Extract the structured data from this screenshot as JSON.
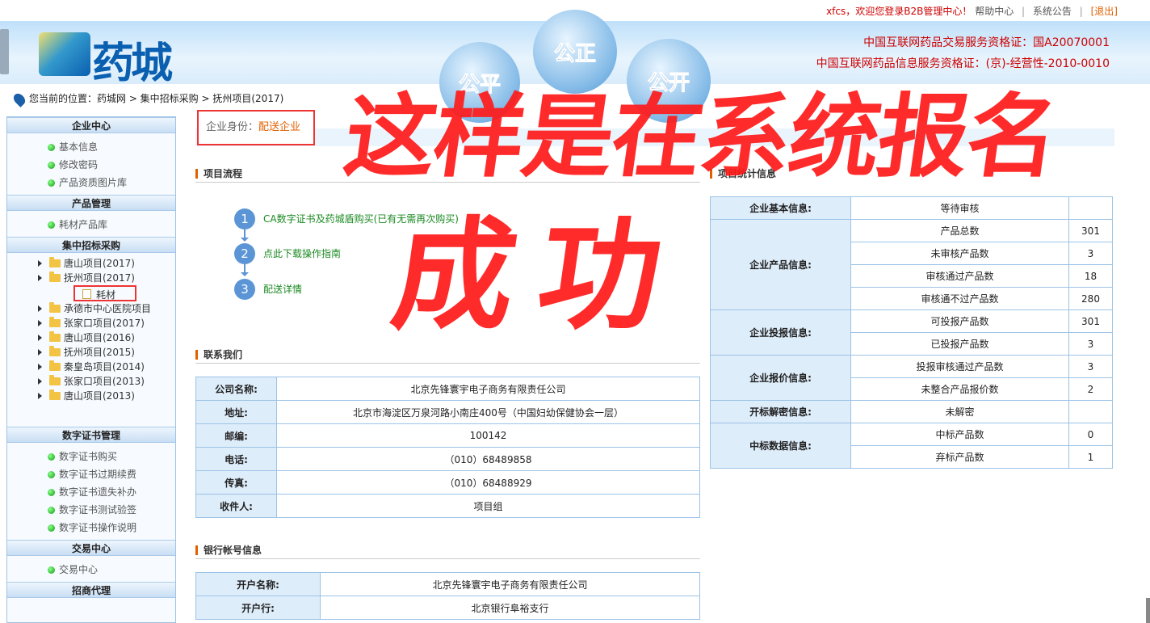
{
  "topbar": {
    "welcome": "xfcs，欢迎您登录B2B管理中心！",
    "help": "帮助中心",
    "notice": "系统公告",
    "logout": "[退出]",
    "sep": "|"
  },
  "header": {
    "logo_text": "药城",
    "bubbles": [
      "公平",
      "公正",
      "公开"
    ],
    "cert1": "中国互联网药品交易服务资格证：国A20070001",
    "cert2": "中国互联网药品信息服务资格证：(京)-经营性-2010-0010"
  },
  "breadcrumb": "您当前的位置：药城网 > 集中招标采购 > 抚州项目(2017)",
  "sidebar": {
    "sections": [
      {
        "title": "企业中心",
        "items": [
          "基本信息",
          "修改密码",
          "产品资质图片库"
        ]
      },
      {
        "title": "产品管理",
        "items": [
          "耗材产品库"
        ]
      },
      {
        "title": "集中招标采购",
        "items": []
      },
      {
        "title": "数字证书管理",
        "items": [
          "数字证书购买",
          "数字证书过期续费",
          "数字证书遗失补办",
          "数字证书测试验签",
          "数字证书操作说明"
        ]
      },
      {
        "title": "交易中心",
        "items": [
          "交易中心"
        ]
      },
      {
        "title": "招商代理",
        "items": []
      }
    ],
    "tree": [
      "唐山项目(2017)",
      "抚州项目(2017)",
      "承德市中心医院项目",
      "张家口项目(2017)",
      "唐山项目(2016)",
      "抚州项目(2015)",
      "秦皇岛项目(2014)",
      "张家口项目(2013)",
      "唐山项目(2013)"
    ],
    "tree_leaf": "耗材"
  },
  "identity": {
    "label": "企业身份：",
    "value": "配送企业"
  },
  "process": {
    "title": "项目流程",
    "steps": [
      {
        "n": "1",
        "label": "CA数字证书及药城盾购买(已有无需再次购买)"
      },
      {
        "n": "2",
        "label": "点此下载操作指南"
      },
      {
        "n": "3",
        "label": "配送详情"
      }
    ]
  },
  "contact": {
    "title": "联系我们",
    "rows": [
      [
        "公司名称:",
        "北京先锋寰宇电子商务有限责任公司"
      ],
      [
        "地址:",
        "北京市海淀区万泉河路小南庄400号（中国妇幼保健协会一层）"
      ],
      [
        "邮编:",
        "100142"
      ],
      [
        "电话:",
        "（010）68489858"
      ],
      [
        "传真:",
        "（010）68488929"
      ],
      [
        "收件人:",
        "项目组"
      ]
    ]
  },
  "bank": {
    "title": "银行帐号信息",
    "rows": [
      [
        "开户名称:",
        "北京先锋寰宇电子商务有限责任公司"
      ],
      [
        "开户行:",
        "北京银行阜裕支行"
      ]
    ]
  },
  "stats": {
    "title": "项目统计信息",
    "groups": [
      {
        "label": "企业基本信息:",
        "rows": [
          [
            "等待审核",
            ""
          ]
        ]
      },
      {
        "label": "企业产品信息:",
        "rows": [
          [
            "产品总数",
            "301"
          ],
          [
            "未审核产品数",
            "3"
          ],
          [
            "审核通过产品数",
            "18"
          ],
          [
            "审核通不过产品数",
            "280"
          ]
        ]
      },
      {
        "label": "企业投报信息:",
        "rows": [
          [
            "可投报产品数",
            "301"
          ],
          [
            "已投报产品数",
            "3"
          ]
        ]
      },
      {
        "label": "企业报价信息:",
        "rows": [
          [
            "投报审核通过产品数",
            "3"
          ],
          [
            "未整合产品报价数",
            "2"
          ]
        ]
      },
      {
        "label": "开标解密信息:",
        "rows": [
          [
            "未解密",
            ""
          ]
        ]
      },
      {
        "label": "中标数据信息:",
        "rows": [
          [
            "中标产品数",
            "0"
          ],
          [
            "弃标产品数",
            "1"
          ]
        ]
      }
    ]
  },
  "annotation": {
    "line1": "这样是在系统报名",
    "line2": "成功"
  }
}
